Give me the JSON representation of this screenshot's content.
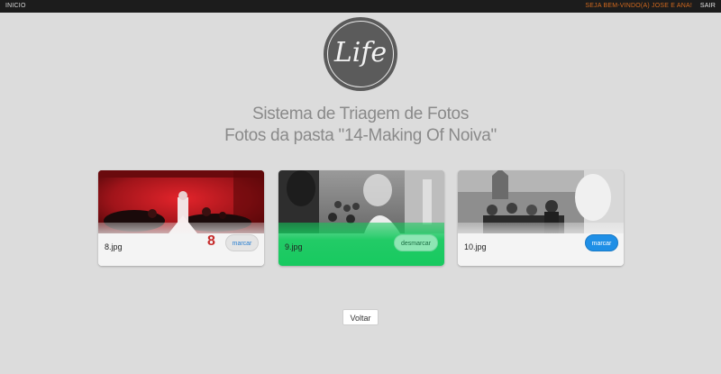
{
  "nav": {
    "home_label": "INICIO",
    "welcome_text": "SEJA BEM-VINDO(A) JOSE E ANA!",
    "logout_label": "SAIR"
  },
  "logo": {
    "text": "Life"
  },
  "header": {
    "title": "Sistema de Triagem de Fotos",
    "subtitle": "Fotos da pasta \"14-Making Of Noiva\""
  },
  "photos": [
    {
      "filename": "8.jpg",
      "button_label": "marcar",
      "count": "8",
      "selected": false
    },
    {
      "filename": "9.jpg",
      "button_label": "desmarcar",
      "selected": true
    },
    {
      "filename": "10.jpg",
      "button_label": "marcar",
      "selected": false
    }
  ],
  "footer": {
    "back_label": "Voltar"
  },
  "colors": {
    "topbar_bg": "#1c1c1c",
    "welcome": "#d2691e",
    "selected_green": "#17c95f",
    "marcar_blue": "#1f8fe6",
    "count_red": "#c62a2a"
  }
}
